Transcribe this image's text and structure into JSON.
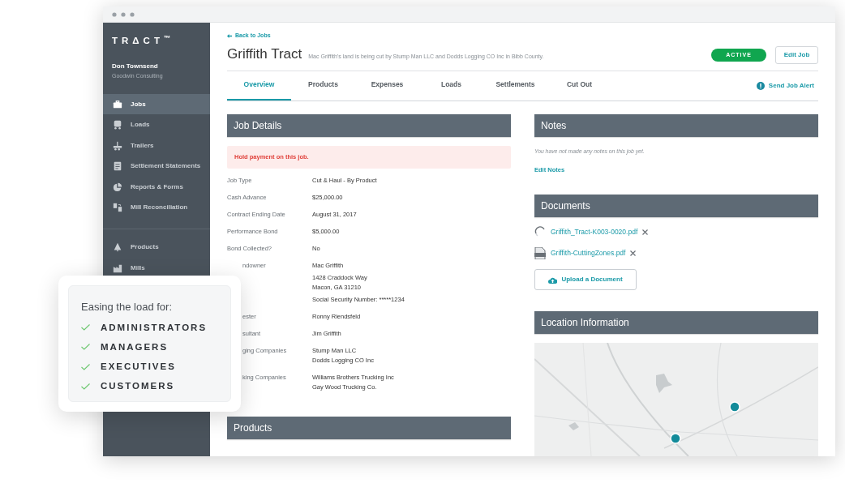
{
  "sidebar": {
    "logo": "TRΔCT$^{™}$",
    "user_name": "Don Townsend",
    "company": "Goodwin Consulting",
    "items": [
      {
        "label": "Jobs",
        "selected": true
      },
      {
        "label": "Loads",
        "selected": false
      },
      {
        "label": "Trailers",
        "selected": false
      },
      {
        "label": "Settlement Statements",
        "selected": false
      },
      {
        "label": "Reports & Forms",
        "selected": false
      },
      {
        "label": "Mill Reconciliation",
        "selected": false
      }
    ],
    "items_secondary": [
      {
        "label": "Products",
        "selected": false
      },
      {
        "label": "Mills",
        "selected": false
      }
    ]
  },
  "header": {
    "back_link": "Back to Jobs",
    "title": "Griffith Tract",
    "subtitle": "Mac Griffith's land is being cut by Stump Man LLC and Dodds Logging CO Inc  in Bibb County.",
    "status": "ACTIVE",
    "edit_button": "Edit Job"
  },
  "tabs": [
    {
      "label": "Overview",
      "selected": true
    },
    {
      "label": "Products",
      "selected": false
    },
    {
      "label": "Expenses",
      "selected": false
    },
    {
      "label": "Loads",
      "selected": false
    },
    {
      "label": "Settlements",
      "selected": false
    },
    {
      "label": "Cut Out",
      "selected": false
    }
  ],
  "alert_link": "Send Job Alert",
  "job_details": {
    "heading": "Job Details",
    "warning": "Hold payment on this job.",
    "fields": [
      {
        "label": "Job Type",
        "values": [
          "Cut & Haul - By Product"
        ]
      },
      {
        "label": "Cash Advance",
        "values": [
          "$25,000.00"
        ]
      },
      {
        "label": "Contract Ending Date",
        "values": [
          "August 31, 2017"
        ]
      },
      {
        "label": "Performance Bond",
        "values": [
          "$5,000.00"
        ]
      },
      {
        "label": "Bond Collected?",
        "values": [
          "No"
        ]
      },
      {
        "label": "ndowner",
        "values": [
          "Mac Griffith",
          "1428 Craddock Way\nMacon, GA 31210",
          "Social Security Number: *****1234"
        ]
      },
      {
        "label": "ester",
        "values": [
          "Ronny Riendsfeld"
        ]
      },
      {
        "label": "sultant",
        "values": [
          "Jim Griffith"
        ]
      },
      {
        "label": "ging Companies",
        "values": [
          "Stump Man LLC\nDodds Logging CO Inc"
        ]
      },
      {
        "label": "king Companies",
        "values": [
          "Williams Brothers Trucking Inc\nGay Wood Trucking Co."
        ]
      }
    ]
  },
  "products": {
    "heading": "Products"
  },
  "notes": {
    "heading": "Notes",
    "empty_text": "You have not made any notes on this job yet.",
    "edit_link": "Edit Notes"
  },
  "documents": {
    "heading": "Documents",
    "files": [
      {
        "name": "Griffith_Tract-K003-0020.pdf",
        "kind": "loading"
      },
      {
        "name": "Griffith-CuttingZones.pdf",
        "kind": "pdf"
      }
    ],
    "upload_button": "Upload a Document"
  },
  "location": {
    "heading": "Location Information"
  },
  "promo": {
    "title": "Easing the load for:",
    "items": [
      "ADMINISTRATORS",
      "MANAGERS",
      "EXECUTIVES",
      "CUSTOMERS"
    ]
  }
}
